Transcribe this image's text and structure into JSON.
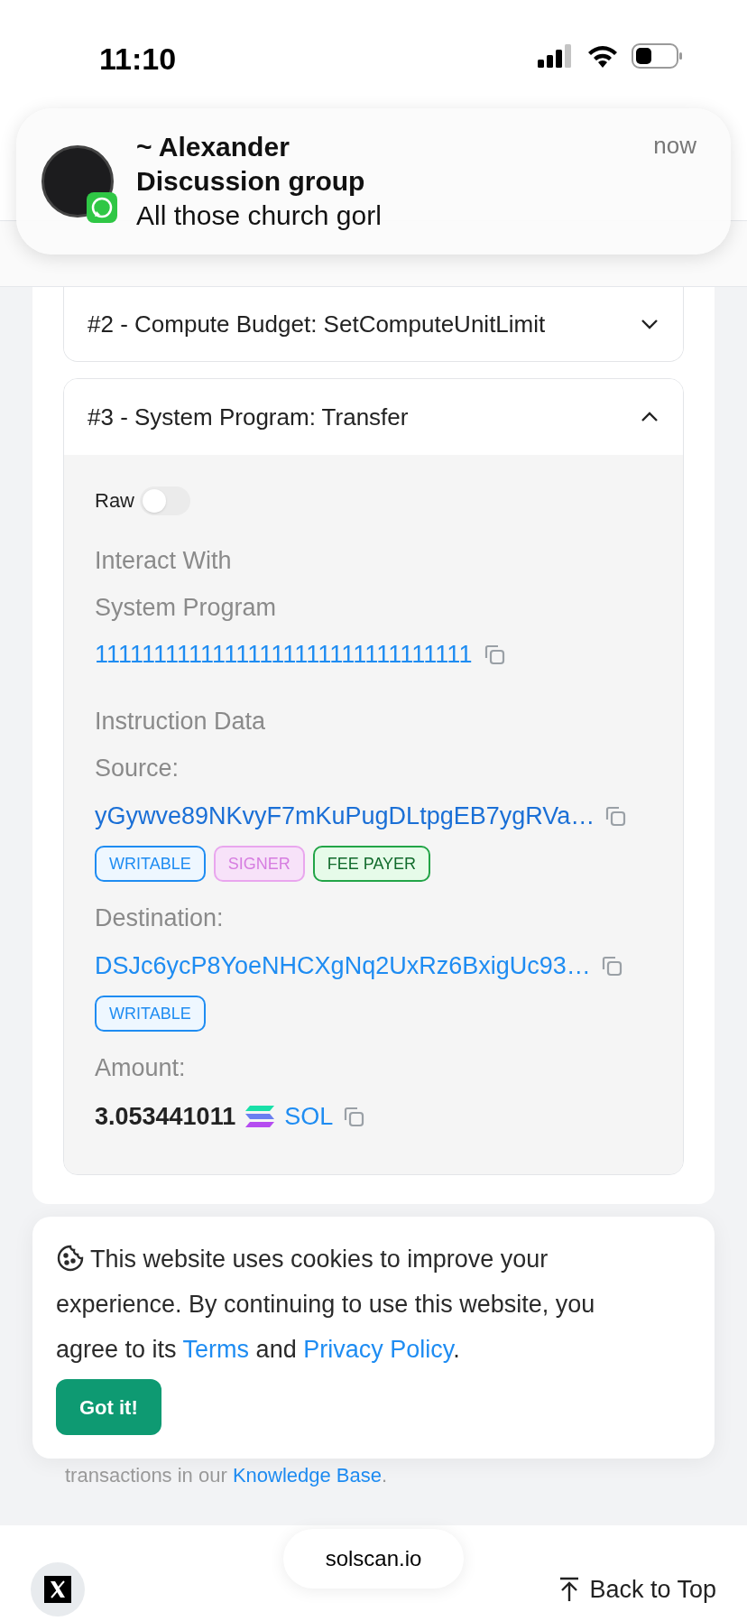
{
  "status_bar": {
    "time": "11:10"
  },
  "notification": {
    "sender": "~ Alexander",
    "group": "Discussion group",
    "message": "All those church gorl",
    "time": "now"
  },
  "instructions": [
    {
      "title": "#2 - Compute Budget: SetComputeUnitLimit",
      "expanded": false
    },
    {
      "title": "#3 - System Program: Transfer",
      "expanded": true
    }
  ],
  "detail": {
    "raw_toggle": {
      "label": "Raw",
      "on": false
    },
    "interact_label": "Interact With",
    "program_name": "System Program",
    "program_address": "11111111111111111111111111111111",
    "data_label": "Instruction Data",
    "accounts": [
      {
        "label": "Source:",
        "address": "yGywve89NKvyF7mKuPugDLtpgEB7ygRVa…",
        "tags": [
          {
            "label": "WRITABLE",
            "kind": "writable"
          },
          {
            "label": "SIGNER",
            "kind": "signer"
          },
          {
            "label": "FEE PAYER",
            "kind": "fee"
          }
        ]
      },
      {
        "label": "Destination:",
        "address": "DSJc6ycP8YoeNHCXgNq2UxRz6BxigUc93…",
        "tags": [
          {
            "label": "WRITABLE",
            "kind": "writable"
          }
        ]
      }
    ],
    "amount_label": "Amount:",
    "amount": "3.053441011",
    "token": "SOL"
  },
  "cookie": {
    "text_before": "This website uses cookies to improve your experience. By continuing to use this website, you agree to its",
    "terms": "Terms",
    "and": "and",
    "privacy": "Privacy Policy",
    "end": ".",
    "button": "Got it!"
  },
  "footer_note": {
    "text": "transactions in our",
    "link": "Knowledge Base",
    "end": "."
  },
  "bottom_bar": {
    "url": "solscan.io",
    "back_to_top": "Back to Top"
  }
}
